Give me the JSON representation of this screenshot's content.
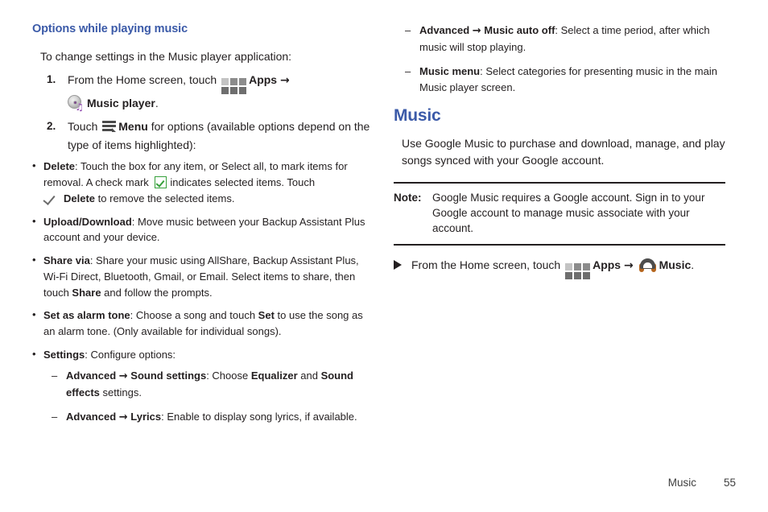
{
  "page": {
    "footer_section": "Music",
    "footer_page_number": "55",
    "heading_color": "#3b5aa8",
    "text_color": "#231f20"
  },
  "left_column": {
    "heading": "Options while playing music",
    "lead": "To change settings in the Music player application:",
    "steps": [
      {
        "number": "1.",
        "pre": "From the Home screen, touch",
        "apps_label": "Apps",
        "arrow": "→",
        "app_label": "Music player",
        "app_suffix": "."
      },
      {
        "number": "2.",
        "pre": "Touch",
        "menu_label": "Menu",
        "post": "for options (available options depend on the type of items highlighted):"
      }
    ],
    "bullets": [
      {
        "term": "Delete",
        "text_a": ": Touch the box for any item, or Select all, to mark items for removal. A check mark",
        "text_b": "indicates selected items. Touch",
        "term_b": "Delete",
        "text_c": "to remove the selected items."
      },
      {
        "term": "Upload/Download",
        "text_a": ": Move music between your Backup Assistant Plus account and your device."
      },
      {
        "term": "Share via",
        "text_a": ": Share your music using AllShare, Backup Assistant Plus, Wi-Fi Direct, Bluetooth, Gmail, or Email. Select items to share, then touch ",
        "term_b": "Share",
        "text_c": " and follow the prompts."
      },
      {
        "term": "Set as alarm tone",
        "text_a": ": Choose a song and touch ",
        "term_b": "Set",
        "text_c": " to use the song as an alarm tone. (Only available for individual songs)."
      },
      {
        "term": "Settings",
        "text_a": ": Configure options:"
      }
    ],
    "sub_items": [
      {
        "term_a": "Advanced",
        "arrow": "→",
        "term_b": "Sound settings",
        "text_a": ": Choose ",
        "term_c": "Equalizer",
        "text_b": " and ",
        "term_d": "Sound effects",
        "text_c": " settings."
      },
      {
        "term_a": "Advanced",
        "arrow": "→",
        "term_b": "Lyrics",
        "text_a": ": Enable to display song lyrics, if available."
      }
    ]
  },
  "right_column": {
    "sub_items": [
      {
        "term_a": "Advanced",
        "arrow": "→",
        "term_b": "Music auto off",
        "text_a": ": Select a time period, after which music will stop playing."
      },
      {
        "term_a": "Music menu",
        "text_a": ": Select categories for presenting music in the main Music player screen."
      }
    ],
    "heading": "Music",
    "intro": "Use Google Music to purchase and download, manage, and play songs synced with your Google account.",
    "note": {
      "label": "Note:",
      "text": "Google Music requires a Google account. Sign in to your Google account to manage music associate with your account."
    },
    "action": {
      "pre": "From the Home screen, touch",
      "apps_label": "Apps",
      "arrow": "→",
      "app_label": "Music",
      "app_suffix": "."
    }
  },
  "icons": {
    "apps_grid": "apps-grid-icon",
    "menu": "menu-icon",
    "music_player_disc": "music-player-disc-icon",
    "checkbox_checked": "checkbox-checked-icon",
    "check_mark": "check-mark-icon",
    "headphones": "headphones-icon",
    "triangle_bullet": "triangle-bullet-icon"
  }
}
